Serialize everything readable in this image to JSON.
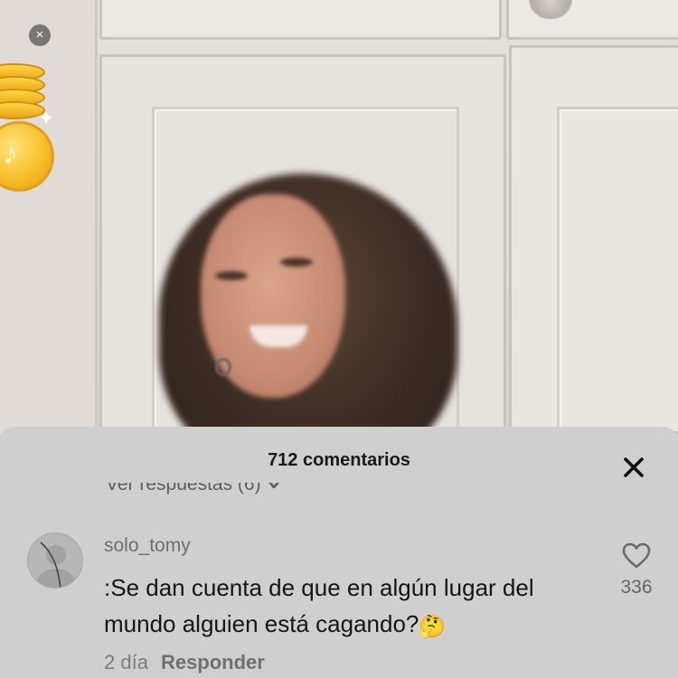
{
  "overlay": {
    "close_glyph": "×",
    "coin_glyph": "♪",
    "sparkle_glyph": "✦"
  },
  "comments": {
    "count_label": "712 comentarios",
    "more_replies_label": "Ver respuestas (6)",
    "items": [
      {
        "username": "solo_tomy",
        "text": ":Se dan cuenta de que en algún lugar del mundo alguien está cagando?",
        "emoji": "🤔",
        "time": "2 día",
        "reply_label": "Responder",
        "likes": "336"
      }
    ]
  },
  "colors": {
    "sheet_bg": "#cfcfcf",
    "text_primary": "#161616",
    "text_secondary": "#6f6f6f",
    "coin": "#f7bf2a"
  }
}
